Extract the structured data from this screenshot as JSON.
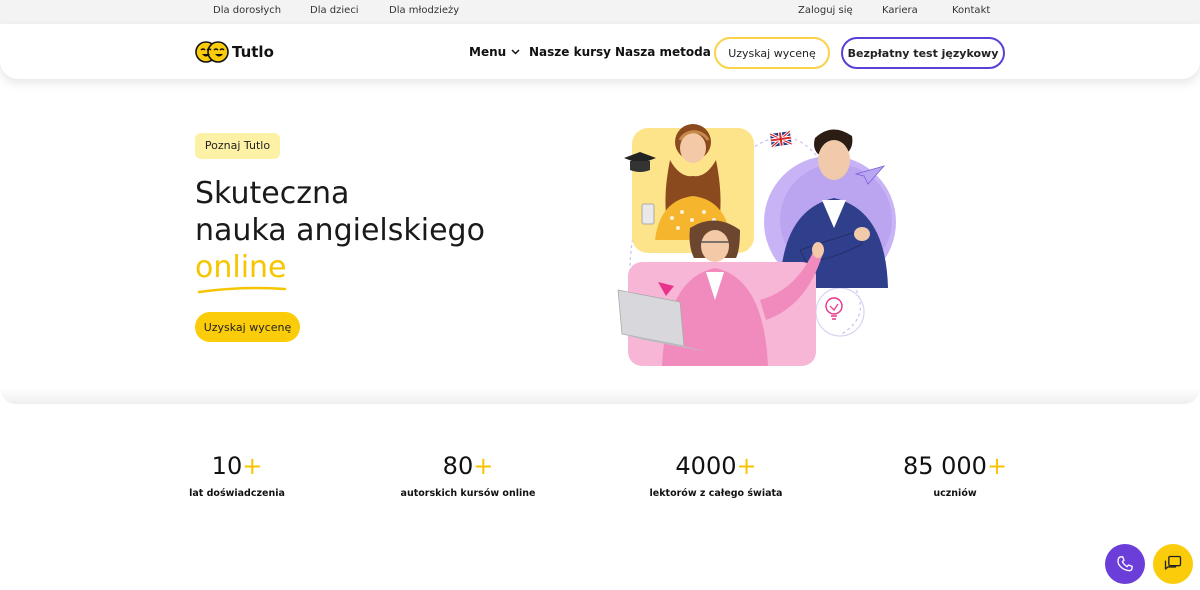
{
  "topbar": {
    "left_links": [
      "Dla dorosłych",
      "Dla dzieci",
      "Dla młodzieży"
    ],
    "right_links": [
      "Zaloguj się",
      "Kariera",
      "Kontakt"
    ]
  },
  "header": {
    "logo_text": "Tutlo",
    "nav": {
      "menu": "Menu",
      "courses": "Nasze kursy",
      "method": "Nasza metoda"
    },
    "quote_button": "Uzyskaj wycenę",
    "test_button": "Bezpłatny test językowy"
  },
  "hero": {
    "badge": "Poznaj Tutlo",
    "title_line1": "Skuteczna",
    "title_line2": "nauka angielskiego",
    "title_highlight": "online",
    "cta": "Uzyskaj wycenę"
  },
  "stats": [
    {
      "value": "10",
      "suffix": "+",
      "label": "lat doświadczenia"
    },
    {
      "value": "80",
      "suffix": "+",
      "label": "autorskich kursów online"
    },
    {
      "value": "4000",
      "suffix": "+",
      "label": "lektorów z całego świata"
    },
    {
      "value": "85 000",
      "suffix": "+",
      "label": "uczniów"
    }
  ],
  "icons": {
    "phone": "phone-icon",
    "chat": "chat-icon",
    "logo": "tutlo-faces-icon",
    "menu_chevron": "chevron-down-icon"
  },
  "colors": {
    "accent_yellow": "#fbcc09",
    "accent_purple": "#5b3fd6",
    "badge_bg": "#fdf1a6",
    "pink": "#f29ac8",
    "lavender": "#c7b3f5"
  }
}
